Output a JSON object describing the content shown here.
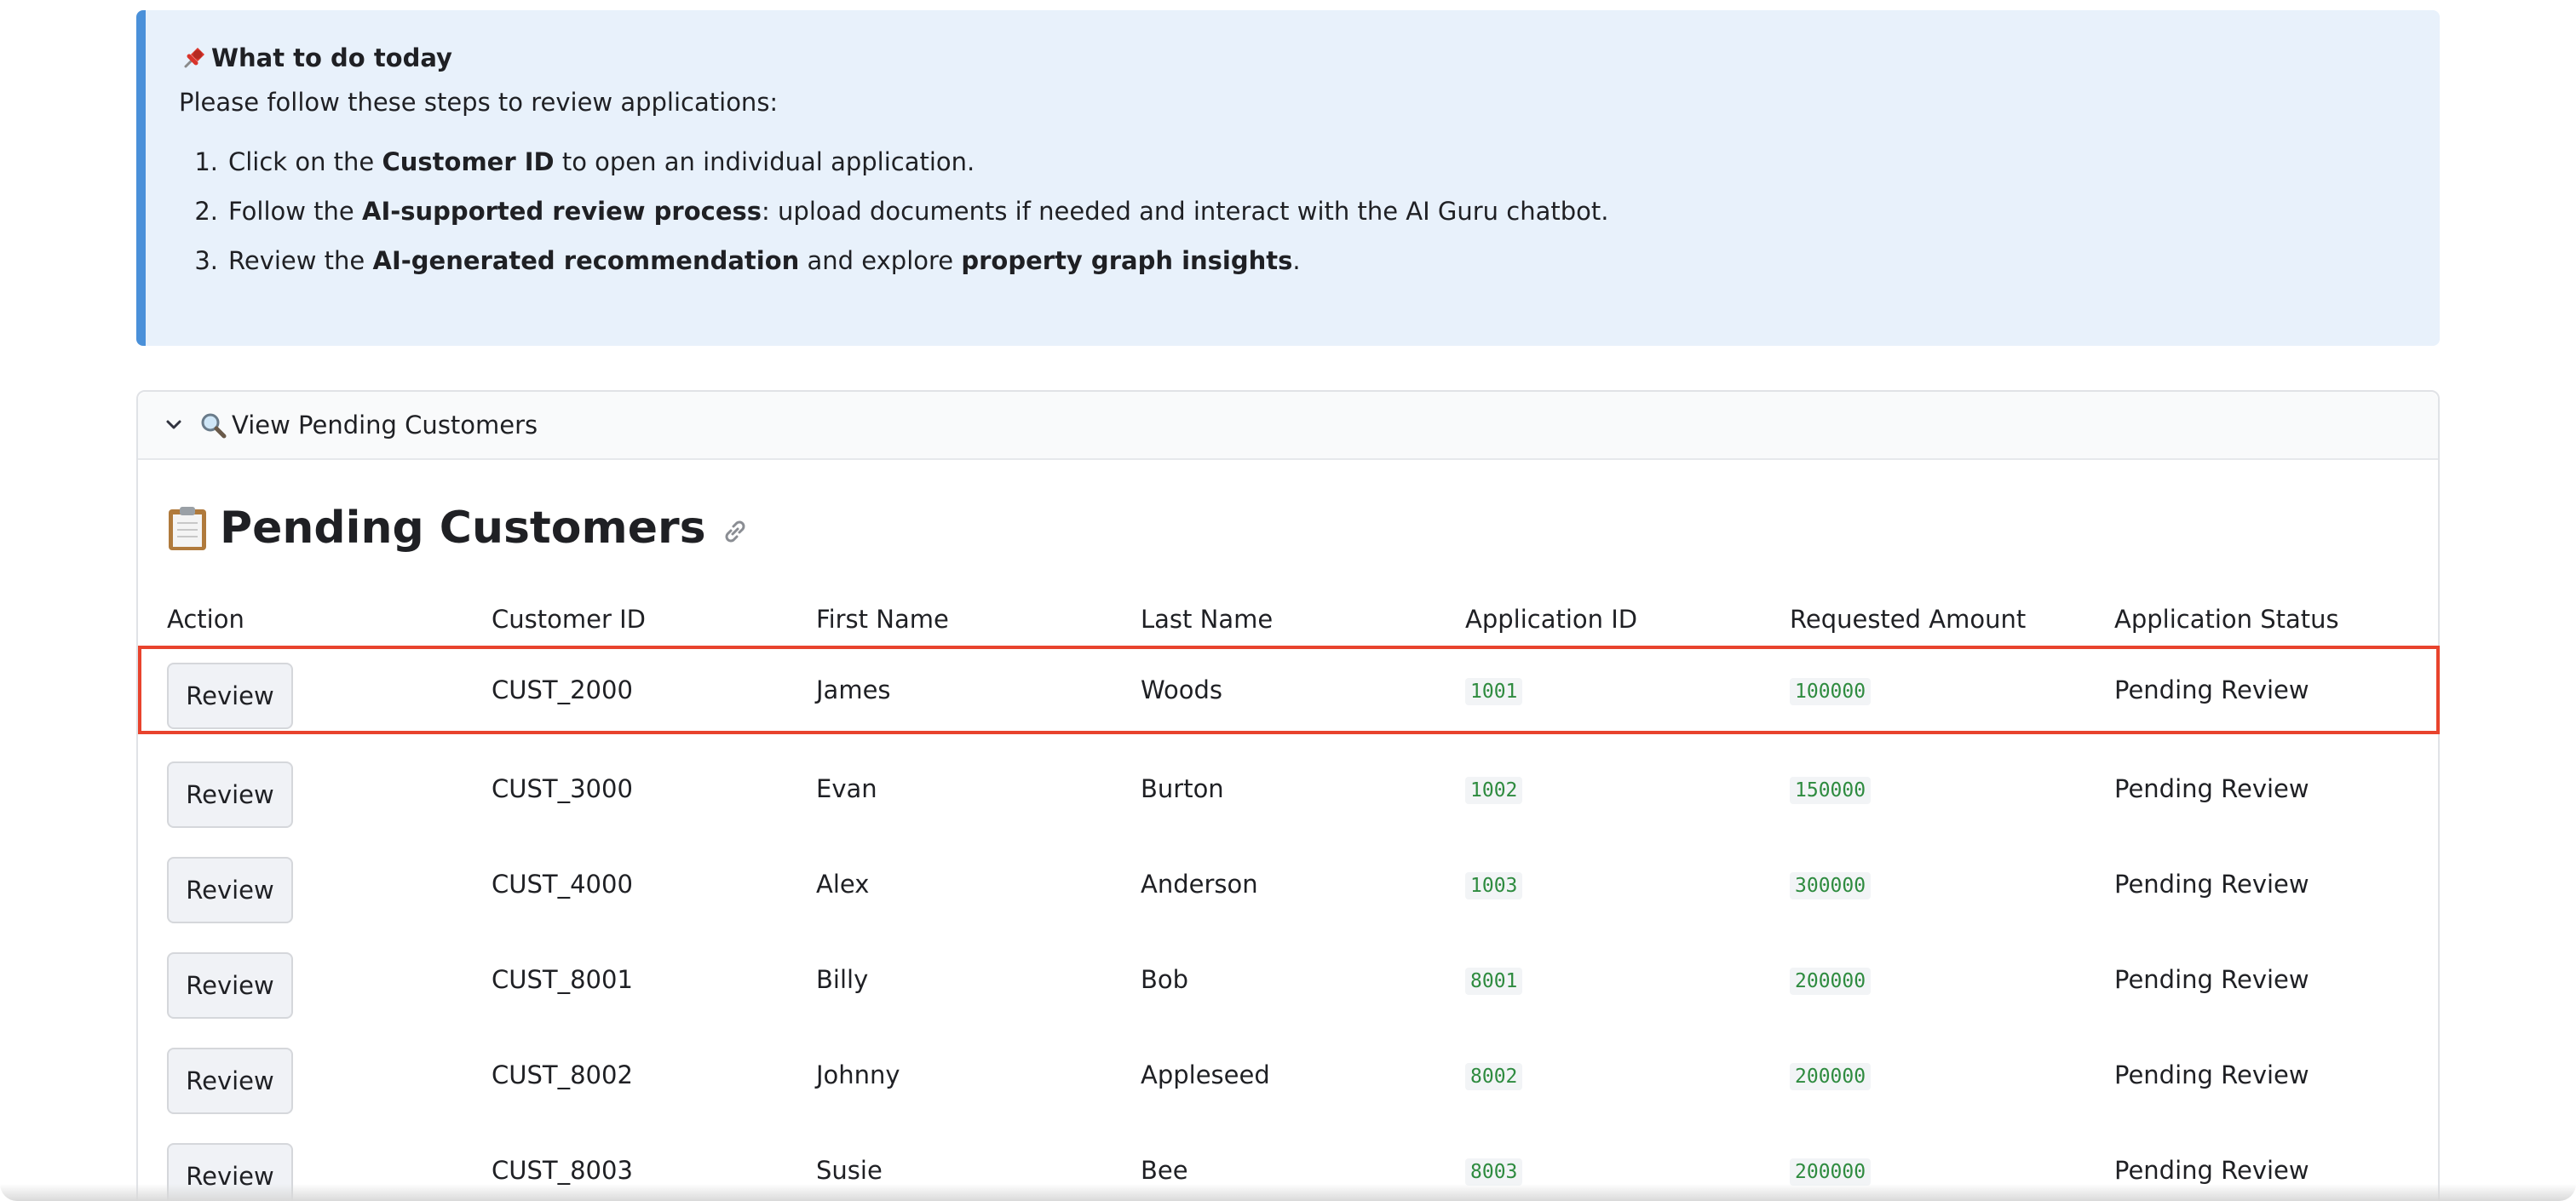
{
  "info": {
    "title": "What to do today",
    "intro": "Please follow these steps to review applications:",
    "steps": [
      {
        "num": "1.",
        "pre": "Click on the ",
        "bold": "Customer ID",
        "post": " to open an individual application."
      },
      {
        "num": "2.",
        "pre": "Follow the ",
        "bold": "AI-supported review process",
        "post": ": upload documents if needed and interact with the AI Guru chatbot."
      },
      {
        "num": "3.",
        "pre": "Review the ",
        "bold": "AI-generated recommendation",
        "mid": " and explore ",
        "bold2": "property graph insights",
        "post": "."
      }
    ]
  },
  "expander": {
    "label": "View Pending Customers"
  },
  "section": {
    "title": "Pending Customers"
  },
  "table": {
    "headers": [
      "Action",
      "Customer ID",
      "First Name",
      "Last Name",
      "Application ID",
      "Requested Amount",
      "Application Status"
    ],
    "rows": [
      {
        "action": "Review",
        "customer_id": "CUST_2000",
        "first": "James",
        "last": "Woods",
        "app_id": "1001",
        "amount": "100000",
        "status": "Pending Review"
      },
      {
        "action": "Review",
        "customer_id": "CUST_3000",
        "first": "Evan",
        "last": "Burton",
        "app_id": "1002",
        "amount": "150000",
        "status": "Pending Review"
      },
      {
        "action": "Review",
        "customer_id": "CUST_4000",
        "first": "Alex",
        "last": "Anderson",
        "app_id": "1003",
        "amount": "300000",
        "status": "Pending Review"
      },
      {
        "action": "Review",
        "customer_id": "CUST_8001",
        "first": "Billy",
        "last": "Bob",
        "app_id": "8001",
        "amount": "200000",
        "status": "Pending Review"
      },
      {
        "action": "Review",
        "customer_id": "CUST_8002",
        "first": "Johnny",
        "last": "Appleseed",
        "app_id": "8002",
        "amount": "200000",
        "status": "Pending Review"
      },
      {
        "action": "Review",
        "customer_id": "CUST_8003",
        "first": "Susie",
        "last": "Bee",
        "app_id": "8003",
        "amount": "200000",
        "status": "Pending Review"
      }
    ]
  },
  "colors": {
    "info_bg": "#e8f1fb",
    "info_border": "#4a90d9",
    "highlight": "#e8432d",
    "code_text": "#2e8b3f"
  },
  "icons": [
    "pushpin-icon",
    "chevron-down-icon",
    "magnifier-icon",
    "clipboard-icon",
    "link-icon"
  ]
}
